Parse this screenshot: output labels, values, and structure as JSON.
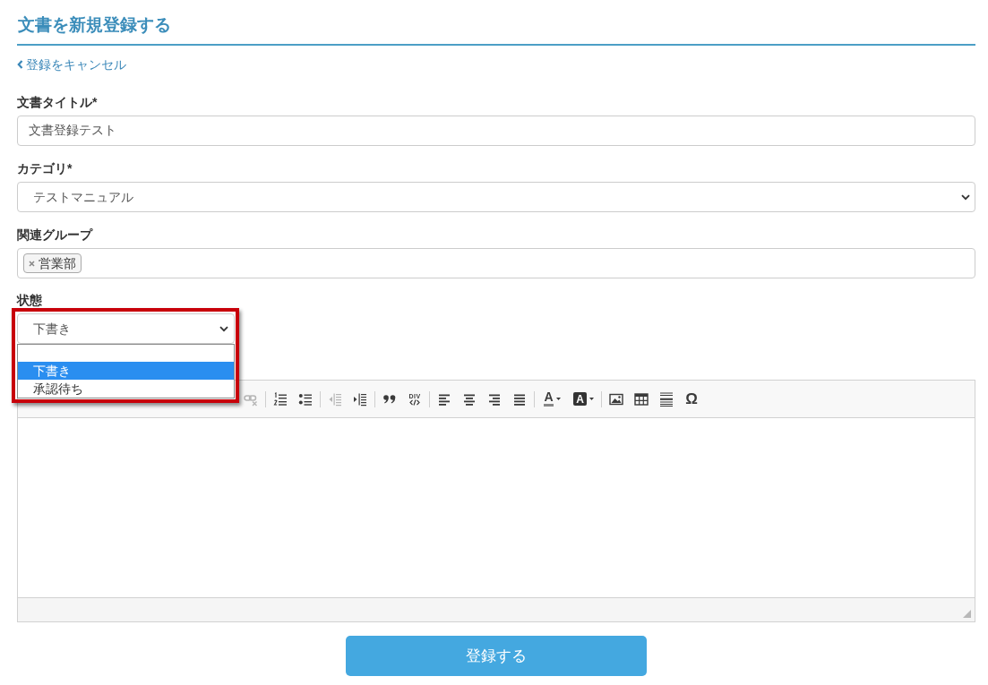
{
  "page": {
    "title": "文書を新規登録する",
    "cancel_link": "登録をキャンセル"
  },
  "form": {
    "title_field": {
      "label": "文書タイトル*",
      "value": "文書登録テスト"
    },
    "category_field": {
      "label": "カテゴリ*",
      "value": "テストマニュアル"
    },
    "group_field": {
      "label": "関連グループ",
      "tags": [
        "営業部"
      ]
    },
    "status_field": {
      "label": "状態",
      "value": "下書き",
      "expanded": true,
      "options": [
        {
          "kind": "blank",
          "selected": false
        },
        {
          "kind": "option",
          "label": "下書き",
          "selected": true
        },
        {
          "kind": "option",
          "label": "承認待ち",
          "selected": false
        }
      ]
    },
    "editor": {
      "toolbar": [
        [
          {
            "kind": "unlink",
            "disabled": true
          }
        ],
        [
          {
            "kind": "numbered-list",
            "disabled": false
          },
          {
            "kind": "bulleted-list",
            "disabled": false
          }
        ],
        [
          {
            "kind": "outdent",
            "disabled": true
          },
          {
            "kind": "indent",
            "disabled": false
          }
        ],
        [
          {
            "kind": "blockquote",
            "disabled": false
          },
          {
            "kind": "div-container",
            "glyph": "DIV",
            "disabled": false
          }
        ],
        [
          {
            "kind": "align-left",
            "disabled": false
          },
          {
            "kind": "align-center",
            "disabled": false
          },
          {
            "kind": "align-right",
            "disabled": false
          },
          {
            "kind": "align-justify",
            "disabled": false
          }
        ],
        [
          {
            "kind": "text-color",
            "glyph": "A",
            "disabled": false
          },
          {
            "kind": "bg-color",
            "glyph": "A",
            "disabled": false
          }
        ],
        [
          {
            "kind": "image",
            "disabled": false
          },
          {
            "kind": "table",
            "disabled": false
          },
          {
            "kind": "horizontal-rule",
            "disabled": false
          },
          {
            "kind": "special-char",
            "glyph": "Ω",
            "disabled": false
          }
        ]
      ]
    }
  },
  "submit_button": "登録する"
}
